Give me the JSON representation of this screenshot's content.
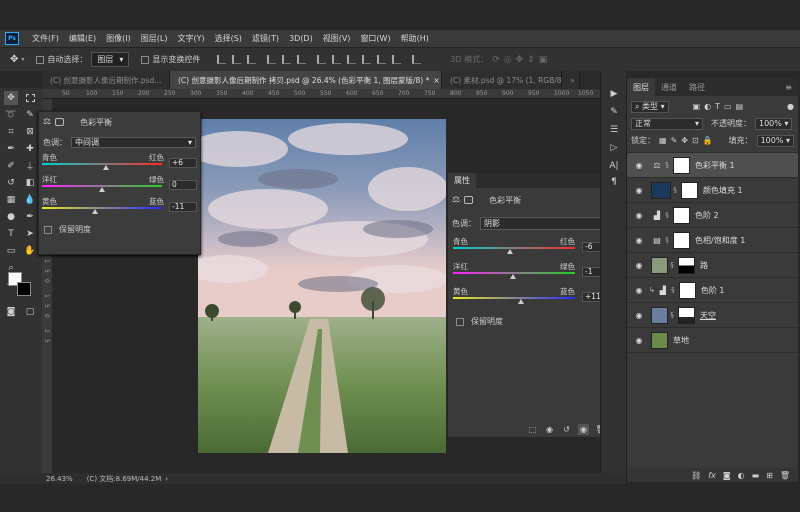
{
  "app": {
    "logo": "Ps"
  },
  "menu": [
    "文件(F)",
    "编辑(E)",
    "图像(I)",
    "图层(L)",
    "文字(Y)",
    "选择(S)",
    "滤镜(T)",
    "3D(D)",
    "视图(V)",
    "窗口(W)",
    "帮助(H)"
  ],
  "options": {
    "auto_select_label": "自动选择：",
    "auto_select_value": "图层",
    "transform_label": "显示变换控件",
    "mode_3d": "3D 模式："
  },
  "tabs": [
    "(C) 创意摄影人像后期制作.psd...",
    "(C) 创意摄影人像后期制作 拷贝.psd @ 26.4% (色彩平衡 1, 图层蒙版/8) *",
    "(C) 素材.psd @ 17% (1, RGB/8..."
  ],
  "ruler_top": [
    "50",
    "100",
    "150",
    "200",
    "250",
    "300",
    "350",
    "400",
    "450",
    "500",
    "550",
    "600",
    "650",
    "700",
    "750",
    "800",
    "850",
    "900",
    "950",
    "1000",
    "1050"
  ],
  "ruler_left": [
    "1",
    "5",
    "0",
    "1",
    "5",
    "0",
    "2",
    "5"
  ],
  "float_panel": {
    "title": "色彩平衡",
    "tone_label": "色调：",
    "tone_value": "中间调",
    "sliders": [
      {
        "left": "青色",
        "right": "红色",
        "value": "+6",
        "pos": 0.53
      },
      {
        "left": "洋红",
        "right": "绿色",
        "value": "0",
        "pos": 0.5
      },
      {
        "left": "黄色",
        "right": "蓝色",
        "value": "-11",
        "pos": 0.44
      }
    ],
    "preserve_label": "保留明度"
  },
  "props_panel": {
    "tab": "属性",
    "title": "色彩平衡",
    "tone_label": "色调：",
    "tone_value": "阴影",
    "sliders": [
      {
        "left": "青色",
        "right": "红色",
        "value": "-6",
        "pos": 0.47
      },
      {
        "left": "洋红",
        "right": "绿色",
        "value": "-1",
        "pos": 0.49
      },
      {
        "left": "黄色",
        "right": "蓝色",
        "value": "+11",
        "pos": 0.56
      }
    ],
    "preserve_label": "保留明度"
  },
  "layers_panel": {
    "tabs": [
      "图层",
      "通道",
      "路径"
    ],
    "kind_label": "类型",
    "blend_mode": "正常",
    "opacity_label": "不透明度：",
    "opacity_value": "100%",
    "lock_label": "锁定：",
    "fill_label": "填充：",
    "fill_value": "100%",
    "layers": [
      {
        "name": "色彩平衡 1",
        "adj": "⚖",
        "thumb": "#ffffff",
        "selected": true
      },
      {
        "name": "颜色填充 1",
        "adj": "",
        "thumb": "#1a3a5c",
        "selected": false
      },
      {
        "name": "色阶 2",
        "adj": "▟",
        "thumb": "#ffffff",
        "selected": false
      },
      {
        "name": "色相/饱和度 1",
        "adj": "▤",
        "thumb": "#ffffff",
        "selected": false
      },
      {
        "name": "路",
        "adj": "",
        "thumb": "#8a9a7a",
        "selected": false
      },
      {
        "name": "色阶 1",
        "adj": "▟",
        "thumb": "#ffffff",
        "selected": false
      },
      {
        "name": "天空",
        "adj": "",
        "thumb": "#6a7fa0",
        "selected": false
      },
      {
        "name": "草地",
        "adj": "",
        "thumb": "#6c8a4a",
        "selected": false
      }
    ]
  },
  "status": {
    "zoom": "26.43%",
    "doc": "(C) 文档:8.69M/44.2M"
  }
}
